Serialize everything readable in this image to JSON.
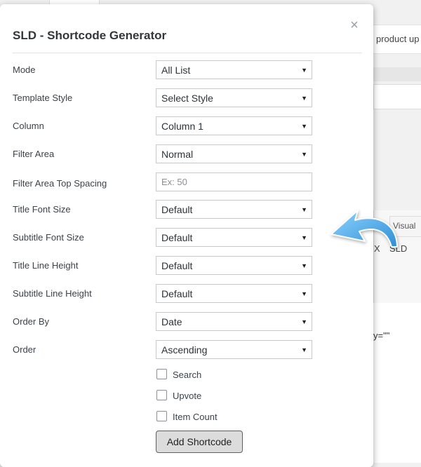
{
  "background": {
    "notice_text": "product up",
    "editor_tab": "Visual",
    "toolbar_x": "X",
    "toolbar_sld": "SLD",
    "code_snippet": "y=\"\""
  },
  "modal": {
    "title": "SLD - Shortcode Generator",
    "close": "×",
    "fields": {
      "mode": {
        "label": "Mode",
        "value": "All List"
      },
      "template_style": {
        "label": "Template Style",
        "value": "Select Style"
      },
      "column": {
        "label": "Column",
        "value": "Column 1"
      },
      "filter_area": {
        "label": "Filter Area",
        "value": "Normal"
      },
      "filter_area_top_spacing": {
        "label": "Filter Area Top Spacing",
        "placeholder": "Ex: 50"
      },
      "title_font_size": {
        "label": "Title Font Size",
        "value": "Default"
      },
      "subtitle_font_size": {
        "label": "Subtitle Font Size",
        "value": "Default"
      },
      "title_line_height": {
        "label": "Title Line Height",
        "value": "Default"
      },
      "subtitle_line_height": {
        "label": "Subtitle Line Height",
        "value": "Default"
      },
      "order_by": {
        "label": "Order By",
        "value": "Date"
      },
      "order": {
        "label": "Order",
        "value": "Ascending"
      }
    },
    "checkboxes": {
      "search": "Search",
      "upvote": "Upvote",
      "item_count": "Item Count"
    },
    "add_button": "Add Shortcode"
  },
  "colors": {
    "arrow": "#3aa6e8",
    "button_bg": "#dcdcdc"
  },
  "caret_glyph": "▼"
}
